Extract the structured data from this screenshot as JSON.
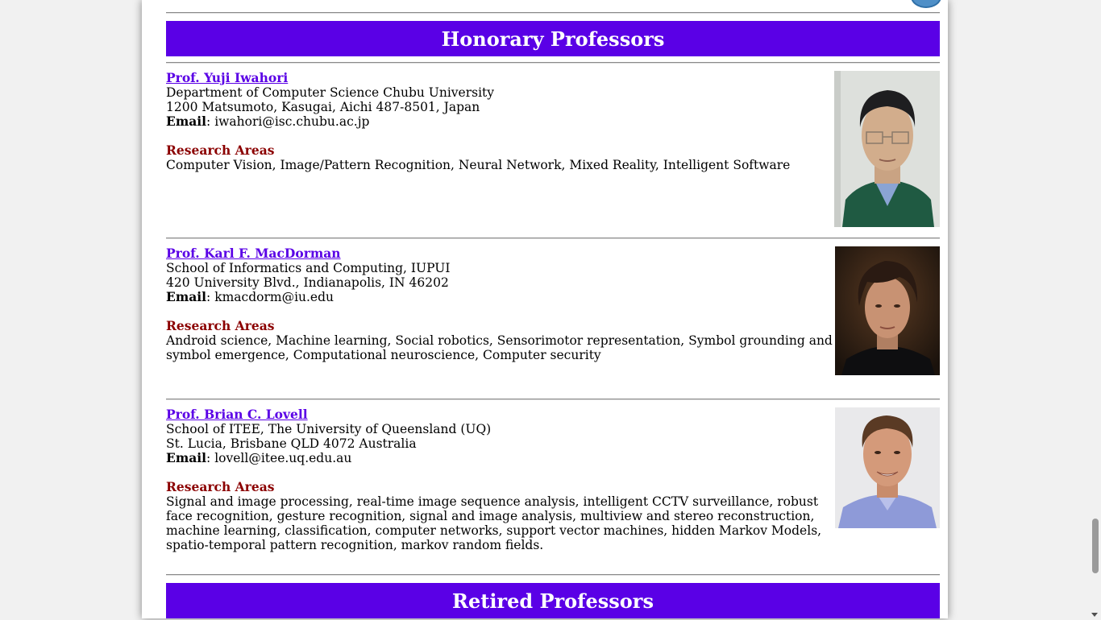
{
  "sections": {
    "honorary_title": "Honorary Professors",
    "retired_title": "Retired Professors"
  },
  "professors": [
    {
      "name": "Prof. Yuji Iwahori",
      "dept": "Department of Computer Science Chubu University",
      "address": "1200 Matsumoto, Kasugai, Aichi 487-8501, Japan",
      "email_label": "Email",
      "email": ": iwahori@isc.chubu.ac.jp",
      "research_title": "Research Areas",
      "research": "Computer Vision, Image/Pattern Recognition, Neural Network, Mixed Reality, Intelligent Software"
    },
    {
      "name": "Prof. Karl F. MacDorman",
      "dept": "School of Informatics and Computing, IUPUI",
      "address": "420 University Blvd., Indianapolis, IN 46202",
      "email_label": "Email",
      "email": ": kmacdorm@iu.edu",
      "research_title": "Research Areas",
      "research": "Android science, Machine learning, Social robotics, Sensorimotor representation, Symbol grounding and symbol emergence, Computational neuroscience, Computer security"
    },
    {
      "name": "Prof. Brian C. Lovell",
      "dept": "School of ITEE, The University of Queensland (UQ)",
      "address": "St. Lucia, Brisbane QLD 4072 Australia",
      "email_label": "Email",
      "email": ": lovell@itee.uq.edu.au",
      "research_title": "Research Areas",
      "research": "Signal and image processing, real-time image sequence analysis, intelligent CCTV surveillance, robust face recognition, gesture recognition, signal and image analysis, multiview and stereo reconstruction, machine learning, classification, computer networks, support vector machines, hidden Markov Models, spatio-temporal pattern recognition, markov random fields."
    }
  ],
  "colors": {
    "banner": "#5a00e6",
    "link": "#5a00e6",
    "research_title": "#8b0000"
  }
}
